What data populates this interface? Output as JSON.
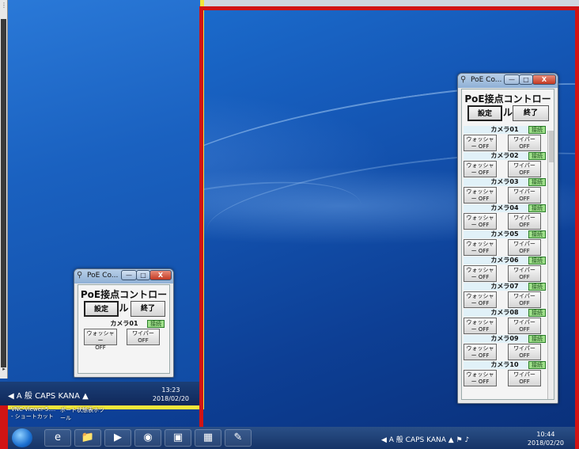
{
  "app": {
    "window_title": "PoE Co...",
    "heading": "PoE接点コントロール",
    "settings_label": "設定",
    "exit_label": "終了",
    "min_glyph": "—",
    "max_glyph": "□",
    "close_glyph": "X"
  },
  "small_app": {
    "camera": {
      "label": "カメラ01",
      "status": "接続",
      "washer": "ウォッシャー\nOFF",
      "wiper": "ワイパー\nOFF"
    }
  },
  "cameras": [
    {
      "label": "カメラ01",
      "status": "接続",
      "washer": "ウォッシャー OFF",
      "wiper": "ワイパー OFF"
    },
    {
      "label": "カメラ02",
      "status": "接続",
      "washer": "ウォッシャー OFF",
      "wiper": "ワイパー OFF"
    },
    {
      "label": "カメラ03",
      "status": "接続",
      "washer": "ウォッシャー OFF",
      "wiper": "ワイパー OFF"
    },
    {
      "label": "カメラ04",
      "status": "接続",
      "washer": "ウォッシャー OFF",
      "wiper": "ワイパー OFF"
    },
    {
      "label": "カメラ05",
      "status": "接続",
      "washer": "ウォッシャー OFF",
      "wiper": "ワイパー OFF"
    },
    {
      "label": "カメラ06",
      "status": "接続",
      "washer": "ウォッシャー OFF",
      "wiper": "ワイパー OFF"
    },
    {
      "label": "カメラ07",
      "status": "接続",
      "washer": "ウォッシャー OFF",
      "wiper": "ワイパー OFF"
    },
    {
      "label": "カメラ08",
      "status": "接続",
      "washer": "ウォッシャー OFF",
      "wiper": "ワイパー OFF"
    },
    {
      "label": "カメラ09",
      "status": "接続",
      "washer": "ウォッシャー OFF",
      "wiper": "ワイパー OFF"
    },
    {
      "label": "カメラ10",
      "status": "接続",
      "washer": "ウォッシャー OFF",
      "wiper": "ワイパー OFF"
    }
  ],
  "inner_taskbar": {
    "time": "13:23",
    "date": "2018/02/20",
    "tray": "◀ A 般 CAPS KANA ▲"
  },
  "desktop_icons": {
    "vnc_label": "VNC-Viewer-5....\n- ショートカット",
    "port_label": "ポート状態表ホツ\nール"
  },
  "taskbar": {
    "time": "10:44",
    "date": "2018/02/20",
    "tray": "◀ A 般 CAPS KANA ▲ ⚑ ♪"
  },
  "taskbar_apps": [
    "e",
    "📁",
    "▶",
    "◉",
    "▣",
    "▦",
    "✎"
  ],
  "colors": {
    "accent_red": "#d11414",
    "accent_yellow": "#f2e63a",
    "status_green": "#9fe08a"
  }
}
